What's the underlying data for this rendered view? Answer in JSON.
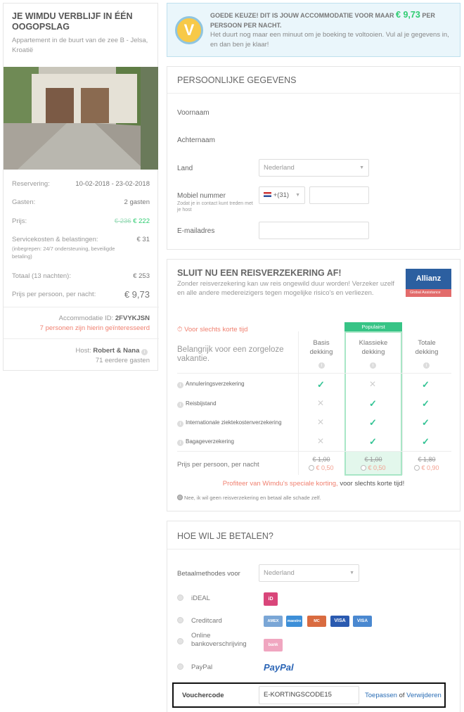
{
  "summary": {
    "title": "JE WIMDU VERBLIJF IN ÉÉN OOGOPSLAG",
    "subtitle": "Appartement in de buurt van de zee B - Jelsa, Kroatië",
    "reservation_label": "Reservering:",
    "reservation_value": "10-02-2018 - 23-02-2018",
    "guests_label": "Gasten:",
    "guests_value": "2 gasten",
    "price_label": "Prijs:",
    "price_old": "€ 236",
    "price_new": "€ 222",
    "service_label": "Servicekosten & belastingen:",
    "service_note": "(inbegrepen: 24/7 ondersteuning, beveiligde betaling)",
    "service_value": "€ 31",
    "total_label": "Totaal (13 nachten):",
    "total_value": "€ 253",
    "pppn_label": "Prijs per persoon, per nacht:",
    "pppn_value": "€ 9,73",
    "accommodation_id_label": "Accommodatie ID:",
    "accommodation_id": "2FVYKJSN",
    "interest_text": "7 personen zijn hierin geïnteresseerd",
    "host_label": "Host:",
    "host_name": "Robert & Nana",
    "host_guests": "71 eerdere gasten"
  },
  "deal": {
    "badge": "V",
    "headline_pre": "GOEDE KEUZE! DIT IS JOUW ACCOMMODATIE VOOR MAAR",
    "headline_price": "€ 9,73",
    "headline_post": "PER PERSOON PER NACHT.",
    "text": "Het duurt nog maar een minuut om je boeking te voltooien. Vul al je gegevens in, en dan ben je klaar!"
  },
  "personal": {
    "title": "PERSOONLIJKE GEGEVENS",
    "firstname_label": "Voornaam",
    "lastname_label": "Achternaam",
    "country_label": "Land",
    "country_value": "Nederland",
    "mobile_label": "Mobiel nummer",
    "mobile_hint": "Zodat je in contact kunt treden met je host",
    "dial_code": "+(31)",
    "email_label": "E-mailadres"
  },
  "insurance": {
    "title": "SLUIT NU EEN REISVERZEKERING AF!",
    "description": "Zonder reisverzekering kan uw reis ongewild duur worden! Verzeker uzelf en alle andere medereizigers tegen mogelijke risico's en verliezen.",
    "logo_text": "Allianz",
    "logo_sub": "Global Assistance",
    "timer_text": "Voor slechts korte tijd",
    "important_text": "Belangrijk voor een zorgeloze vakantie.",
    "popular_label": "Populairst",
    "plans": [
      {
        "name": "Basis dekking",
        "old": "€ 1,00",
        "new": "€ 0,50"
      },
      {
        "name": "Klassieke dekking",
        "old": "€ 1,00",
        "new": "€ 0,50"
      },
      {
        "name": "Totale dekking",
        "old": "€ 1,80",
        "new": "€ 0,90"
      }
    ],
    "rows": [
      {
        "label": "Annuleringsverzekering"
      },
      {
        "label": "Reisbijstand"
      },
      {
        "label": "Internationale ziektekostenverzekering"
      },
      {
        "label": "Bagageverzekering"
      }
    ],
    "price_row_label": "Prijs per persoon, per nacht",
    "promo_red": "Profiteer van Wimdu's speciale korting,",
    "promo_rest": "voor slechts korte tijd!",
    "decline_text": "Nee, ik wil geen reisverzekering en betaal alle schade zelf."
  },
  "payment": {
    "title": "HOE WIL JE BETALEN?",
    "methods_label": "Betaalmethodes voor",
    "country_value": "Nederland",
    "ideal_label": "iDEAL",
    "credit_label": "Creditcard",
    "bank_label": "Online bankoverschrijving",
    "paypal_label": "PayPal",
    "logos": {
      "ideal": "iD",
      "amex": "AMEX",
      "maestro": "maestro",
      "mastercard": "MC",
      "visa": "VISA",
      "visa2": "VISA",
      "bank": "bank",
      "paypal": "PayPal"
    },
    "voucher_label": "Vouchercode",
    "voucher_value": "E-KORTINGSCODE15",
    "apply_label": "Toepassen",
    "or_label": "of",
    "remove_label": "Verwijderen"
  },
  "colors": {
    "accent_green": "#2ecc71",
    "check_green": "#35c495",
    "promo_red": "#f08070",
    "link_blue": "#2a6db5",
    "allianz_blue": "#2c5fa0"
  }
}
